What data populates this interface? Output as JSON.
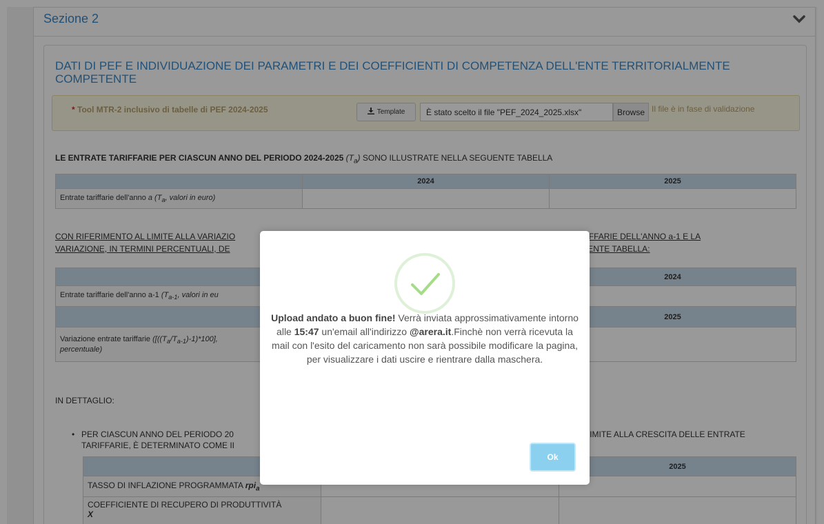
{
  "section": {
    "title": "Sezione 2",
    "toggle_icon": "chevron-down-icon"
  },
  "panel": {
    "title": "DATI DI PEF E INDIVIDUAZIONE DEI PARAMETRI E DEI COEFFICIENTI DI COMPETENZA DELL'ENTE TERRITORIALMENTE COMPETENTE"
  },
  "upload": {
    "required_mark": "*",
    "tool_label": "Tool MTR-2 inclusivo di tabelle di PEF 2024-2025",
    "template_label": "Template",
    "file_value": "È stato scelto il file \"PEF_2024_2025.xlsx\"",
    "browse_label": "Browse",
    "status_text": "Il file è in fase di validazione"
  },
  "heading1": {
    "bold": "LE ENTRATE TARIFFARIE PER CIASCUN ANNO DEL PERIODO 2024-2025",
    "math": "(Ta)",
    "rest": "SONO ILLUSTRATE NELLA SEGUENTE TABELLA"
  },
  "table1": {
    "col1": "2024",
    "col2": "2025",
    "row_label": "Entrate tariffarie dell'anno a (Ta, valori in euro)"
  },
  "para2": {
    "line1_left": "CON RIFERIMENTO AL LIMITE ALLA VARIAZIO",
    "line1_right": "E TARIFFARIE DELL'ANNO a-1 E LA",
    "line2_left": "VARIAZIONE, IN TERMINI PERCENTUALI, DE",
    "line2_right": "UENTE TABELLA:"
  },
  "table2": {
    "col2024": "2024",
    "row1_label": "Entrate tariffarie dell'anno a-1 (Ta-1, valori in eu",
    "col2025": "2025",
    "row2_label": "Variazione entrate tariffarie ([((Ta/Ta-1)-1)*100],",
    "row2_label_line2": "percentuale)"
  },
  "in_dettaglio": "IN DETTAGLIO:",
  "bullet": {
    "line1_left": "PER CIASCUN ANNO DEL PERIODO 20",
    "line1_right": "L LIMITE ALLA CRESCITA DELLE ENTRATE",
    "line2": "TARIFFARIE, È DETERMINATO COME II"
  },
  "table3": {
    "col2025": "2025",
    "row1_label": "TASSO DI INFLAZIONE PROGRAMMATA rpia",
    "row2_label": "COEFFICIENTE DI RECUPERO DI PRODUTTIVITÀ",
    "row2_label_line2": "X"
  },
  "modal": {
    "icon": "success-check-icon",
    "bold_start": "Upload andato a buon fine!",
    "text1": " Verrà inviata approssimativamente intorno alle ",
    "time": "15:47",
    "text2": " un'email all'indirizzo ",
    "email": "@arera.it",
    "text3": ".Finchè non verrà ricevuta la mail con l'esito del caricamento non sarà possibile modificare la pagina, per visualizzare i dati uscire e rientrare dalla maschera.",
    "ok_label": "Ok"
  }
}
